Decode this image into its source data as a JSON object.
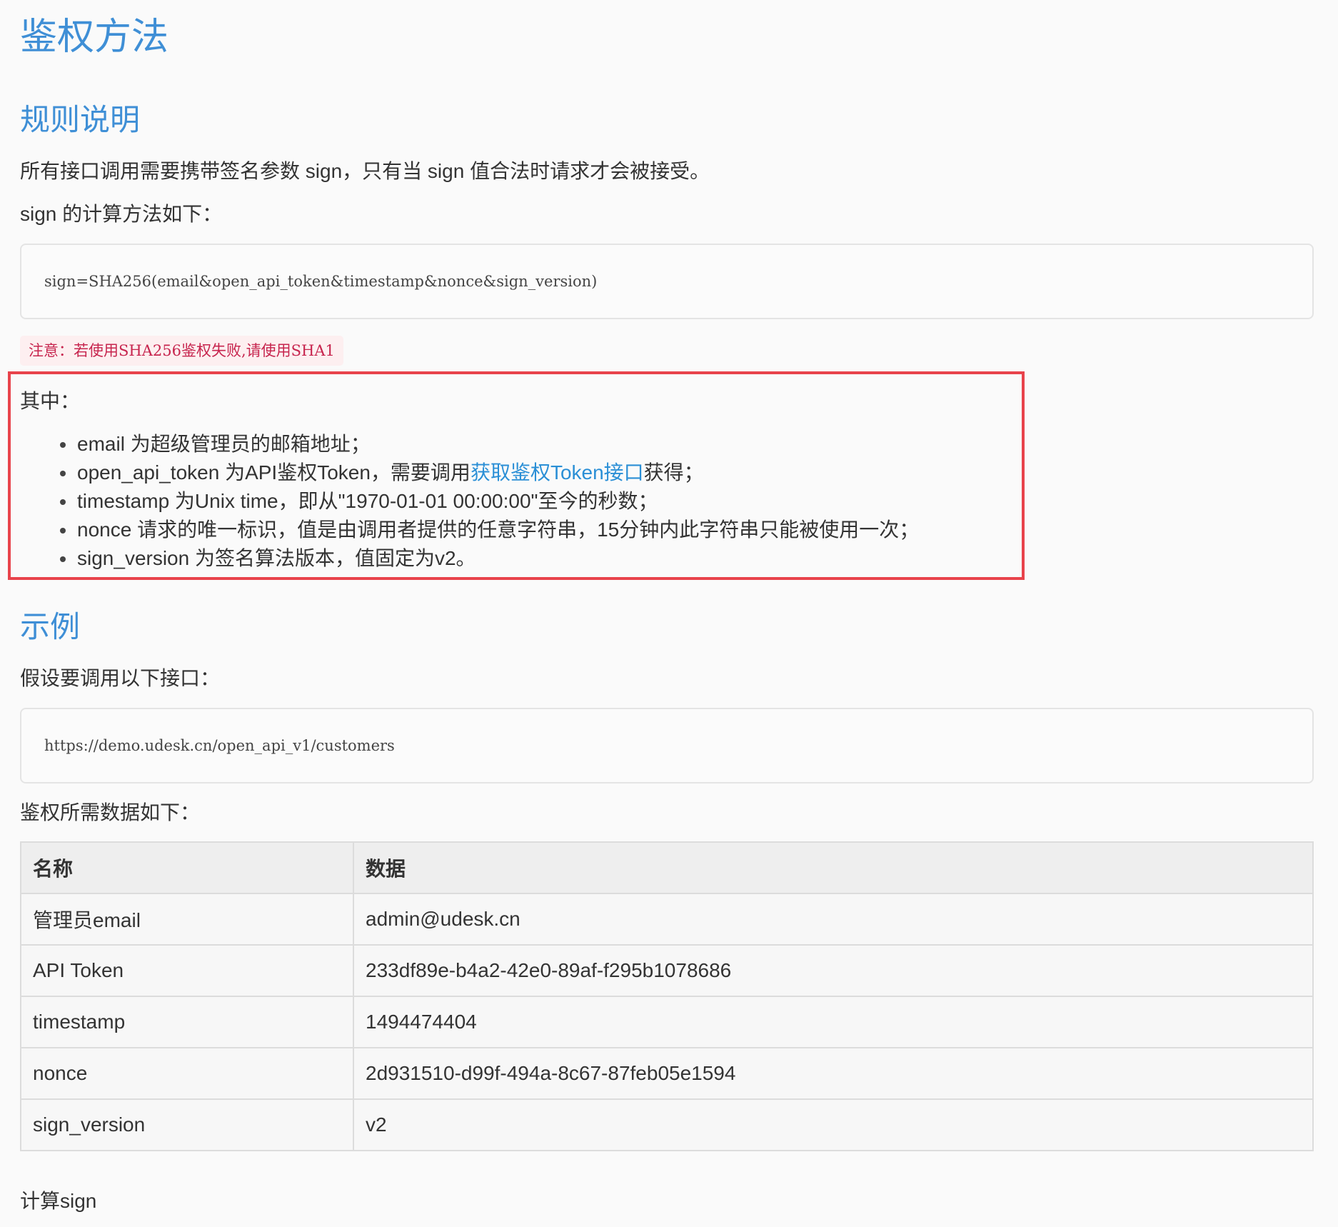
{
  "title": "鉴权方法",
  "rules": {
    "heading": "规则说明",
    "intro": "所有接口调用需要携带签名参数 sign，只有当 sign 值合法时请求才会被接受。",
    "calc_label": "sign 的计算方法如下：",
    "formula": "sign=SHA256(email&open_api_token&timestamp&nonce&sign_version)",
    "note": "注意：若使用SHA256鉴权失败,请使用SHA1",
    "where_label": "其中：",
    "items": [
      {
        "text": "email 为超级管理员的邮箱地址；"
      },
      {
        "pre": "open_api_token 为API鉴权Token，需要调用",
        "link": "获取鉴权Token接口",
        "post": "获得；"
      },
      {
        "text": "timestamp 为Unix time，即从\"1970-01-01 00:00:00\"至今的秒数；"
      },
      {
        "text": "nonce 请求的唯一标识，值是由调用者提供的任意字符串，15分钟内此字符串只能被使用一次；"
      },
      {
        "text": "sign_version 为签名算法版本，值固定为v2。"
      }
    ]
  },
  "example": {
    "heading": "示例",
    "intro": "假设要调用以下接口：",
    "url": "https://demo.udesk.cn/open_api_v1/customers",
    "table_label": "鉴权所需数据如下：",
    "table": {
      "headers": [
        "名称",
        "数据"
      ],
      "rows": [
        [
          "管理员email",
          "admin@udesk.cn"
        ],
        [
          "API Token",
          "233df89e-b4a2-42e0-89af-f295b1078686"
        ],
        [
          "timestamp",
          "1494474404"
        ],
        [
          "nonce",
          "2d931510-d99f-494a-8c67-87feb05e1594"
        ],
        [
          "sign_version",
          "v2"
        ]
      ]
    },
    "calc_heading": "计算sign"
  },
  "colors": {
    "heading": "#3f8fd6",
    "link": "#2a8fd6",
    "note_text": "#c7254e",
    "highlight_box": "#e8434b"
  }
}
